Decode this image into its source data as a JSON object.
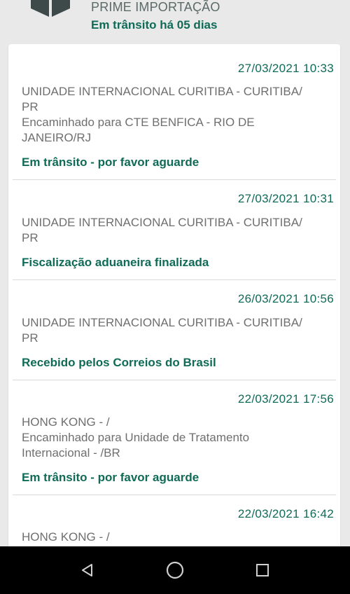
{
  "header": {
    "service": "PRIME IMPORTAÇÃO",
    "status": "Em trânsito há 05 dias"
  },
  "events": [
    {
      "date": "27/03/2021 10:33",
      "location_lines": [
        "UNIDADE INTERNACIONAL CURITIBA - CURITIBA/",
        "PR",
        "Encaminhado para CTE BENFICA - RIO DE",
        "JANEIRO/RJ"
      ],
      "status": "Em trânsito - por favor aguarde"
    },
    {
      "date": "27/03/2021 10:31",
      "location_lines": [
        "UNIDADE INTERNACIONAL CURITIBA - CURITIBA/",
        "PR"
      ],
      "status": "Fiscalização aduaneira finalizada"
    },
    {
      "date": "26/03/2021 10:56",
      "location_lines": [
        "UNIDADE INTERNACIONAL CURITIBA - CURITIBA/",
        "PR"
      ],
      "status": "Recebido pelos Correios do Brasil"
    },
    {
      "date": "22/03/2021 17:56",
      "location_lines": [
        "HONG KONG - /",
        "Encaminhado para Unidade de Tratamento",
        "Internacional - /BR"
      ],
      "status": "Em trânsito - por favor aguarde"
    },
    {
      "date": "22/03/2021 16:42",
      "location_lines": [
        "HONG KONG - /"
      ],
      "status": ""
    }
  ],
  "navbar": {
    "icons": [
      "back-icon",
      "home-icon",
      "recents-icon"
    ]
  },
  "colors": {
    "accent": "#0f6b57",
    "muted": "#6f6f6f",
    "background": "#e9e9e9"
  }
}
